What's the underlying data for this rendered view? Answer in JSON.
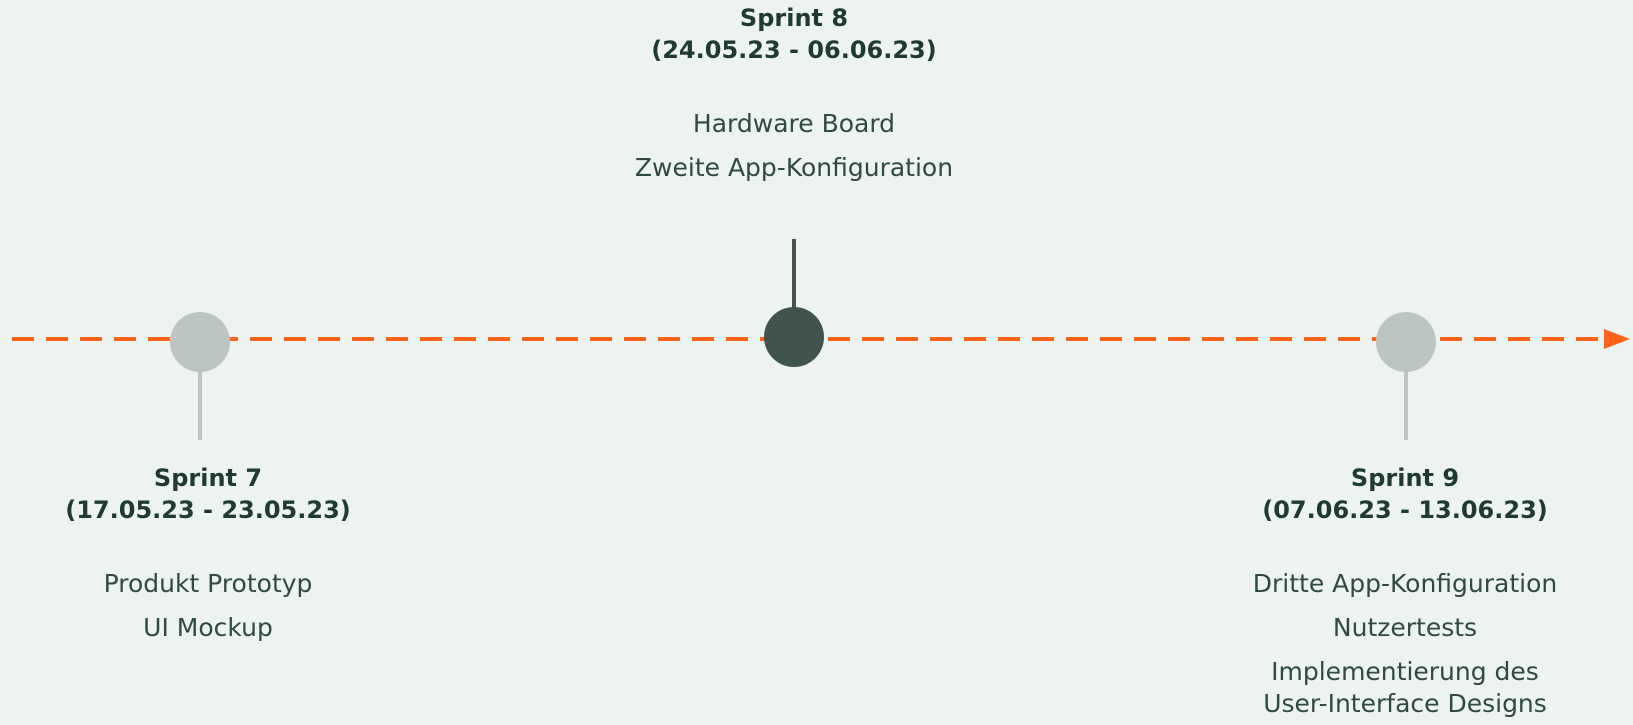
{
  "diagram": {
    "colors": {
      "background": "#edf3f0",
      "timeline": "#ff6319",
      "milestone_inactive": "#bcc5c1",
      "milestone_active": "#41534f",
      "text": "#1f3a31"
    },
    "timeline_arrow_icon": "arrow-right-icon",
    "sprints": [
      {
        "title": "Sprint 7",
        "dates": "(17.05.23 - 23.05.23)",
        "tasks": [
          "Produkt Prototyp",
          "UI Mockup"
        ],
        "active": false
      },
      {
        "title": "Sprint 8",
        "dates": "(24.05.23 - 06.06.23)",
        "tasks": [
          "Hardware Board",
          "Zweite App-Konfiguration"
        ],
        "active": true
      },
      {
        "title": "Sprint 9",
        "dates": "(07.06.23 - 13.06.23)",
        "tasks": [
          "Dritte App-Konfiguration",
          "Nutzertests",
          "Implementierung des User-Interface Designs"
        ],
        "active": false
      }
    ]
  }
}
